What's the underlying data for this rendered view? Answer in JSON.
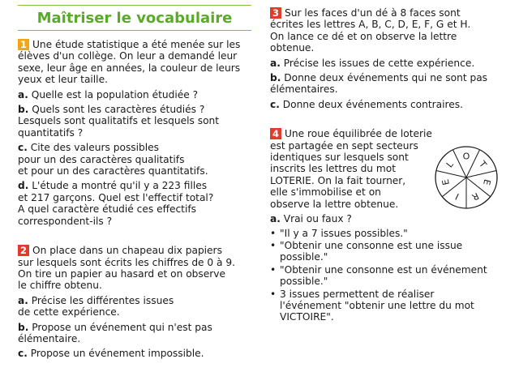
{
  "title": "Maîtriser le vocabulaire",
  "ex1": {
    "num": "1",
    "lines": [
      "Une étude statistique a été menée sur les",
      "élèves d'un collège. On leur a demandé leur",
      "sexe, leur âge en années, la couleur de leurs",
      "yeux et leur taille."
    ],
    "a_label": "a.",
    "a_lines": [
      "Quelle est la population étudiée ?"
    ],
    "b_label": "b.",
    "b_lines": [
      "Quels sont les caractères étudiés ?",
      "Lesquels sont qualitatifs et lesquels sont",
      "quantitatifs ?"
    ],
    "c_label": "c.",
    "c_lines": [
      "Cite des valeurs possibles",
      "pour un des caractères qualitatifs",
      "et pour un des caractères quantitatifs."
    ],
    "d_label": "d.",
    "d_lines": [
      "L'étude a montré qu'il y a 223 filles",
      "et 217 garçons. Quel est l'effectif total?",
      "A quel caractère étudié ces effectifs",
      "correspondent-ils ?"
    ]
  },
  "ex2": {
    "num": "2",
    "lines": [
      "On place dans un chapeau dix papiers",
      "sur lesquels sont écrits les chiffres de 0 à 9.",
      "On tire un papier au hasard et on observe",
      "le chiffre obtenu."
    ],
    "a_label": "a.",
    "a_lines": [
      "Précise les différentes issues",
      "de cette expérience."
    ],
    "b_label": "b.",
    "b_lines": [
      "Propose un événement qui n'est pas",
      "élémentaire."
    ],
    "c_label": "c.",
    "c_lines": [
      "Propose un événement impossible."
    ]
  },
  "ex3": {
    "num": "3",
    "lines": [
      "Sur les faces d'un dé à 8 faces sont",
      "écrites les lettres A, B, C, D, E, F, G et H.",
      "On lance ce dé et on observe la lettre",
      "obtenue."
    ],
    "a_label": "a.",
    "a_lines": [
      "Précise les issues de cette expérience."
    ],
    "b_label": "b.",
    "b_lines": [
      "Donne deux événements qui ne sont pas",
      "élémentaires."
    ],
    "c_label": "c.",
    "c_lines": [
      "Donne deux événements contraires."
    ]
  },
  "ex4": {
    "num": "4",
    "lines": [
      "Une roue équilibrée de loterie",
      "est partagée en sept secteurs",
      "identiques sur lesquels sont",
      "inscrits les lettres du mot",
      "LOTERIE. On la fait tourner,",
      "elle s'immobilise et on",
      "observe la lettre obtenue."
    ],
    "a_label": "a.",
    "a_lines": [
      "Vrai ou faux ?"
    ],
    "bullets": [
      [
        "\"Il y a 7 issues possibles.\""
      ],
      [
        "\"Obtenir une consonne est une issue",
        "possible.\""
      ],
      [
        "\"Obtenir une consonne est un événement",
        "possible.\""
      ],
      [
        "3 issues permettent de réaliser",
        "l'événement \"obtenir une lettre du mot",
        "VICTOIRE\"."
      ]
    ],
    "wheel_letters": [
      "L",
      "O",
      "T",
      "E",
      "R",
      "I",
      "E"
    ]
  },
  "colors": {
    "title": "#5aaa2a",
    "rule": "#7fbf3f",
    "num_orange": "#f2a516",
    "num_red": "#e23a2b"
  }
}
